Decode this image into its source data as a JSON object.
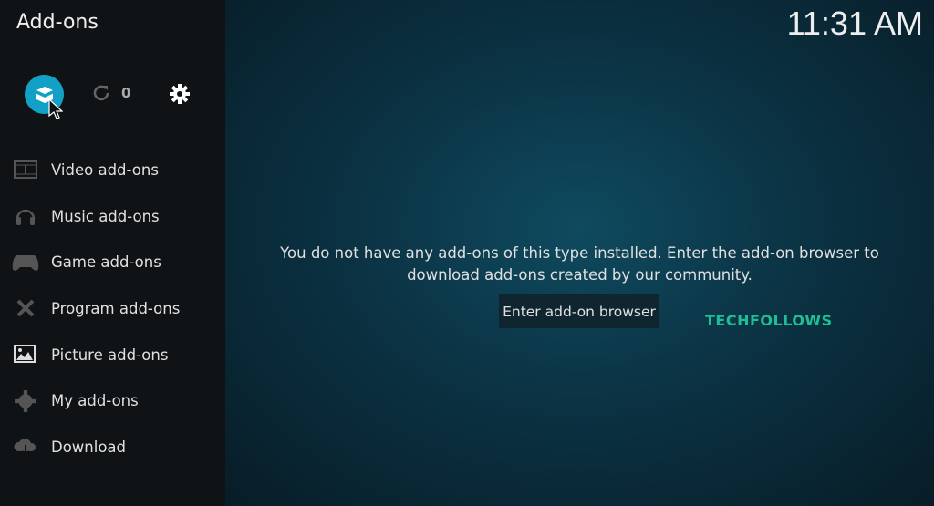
{
  "header": {
    "title": "Add-ons",
    "clock": "11:31 AM"
  },
  "toolbar": {
    "updates_count": "0",
    "accent": "#12a0c6"
  },
  "sidebar": {
    "items": [
      {
        "label": "Video add-ons",
        "icon": "film-icon"
      },
      {
        "label": "Music add-ons",
        "icon": "headphones-icon"
      },
      {
        "label": "Game add-ons",
        "icon": "gamepad-icon"
      },
      {
        "label": "Program add-ons",
        "icon": "tools-icon"
      },
      {
        "label": "Picture add-ons",
        "icon": "picture-icon"
      },
      {
        "label": "My add-ons",
        "icon": "gear-tools-icon"
      },
      {
        "label": "Download",
        "icon": "cloud-download-icon"
      }
    ]
  },
  "main": {
    "message": "You do not have any add-ons of this type installed. Enter the add-on browser to download add-ons created by our community.",
    "button": "Enter add-on browser"
  },
  "watermark": "TECHFOLLOWS"
}
